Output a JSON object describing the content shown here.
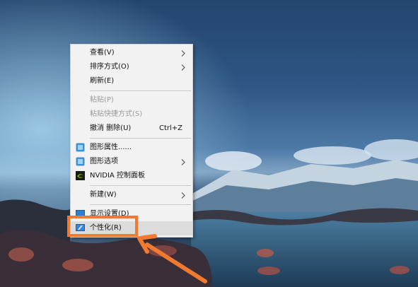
{
  "menu": {
    "items": [
      {
        "label": "查看(V)",
        "submenu": true
      },
      {
        "label": "排序方式(O)",
        "submenu": true
      },
      {
        "label": "刷新(E)"
      },
      {
        "label": "粘贴(P)",
        "disabled": true
      },
      {
        "label": "粘贴快捷方式(S)",
        "disabled": true
      },
      {
        "label": "撤消 删除(U)",
        "shortcut": "Ctrl+Z"
      },
      {
        "label": "图形属性......",
        "icon": "intel-graphics-icon"
      },
      {
        "label": "图形选项",
        "icon": "intel-graphics-icon",
        "submenu": true
      },
      {
        "label": "NVIDIA 控制面板",
        "icon": "nvidia-icon"
      },
      {
        "label": "新建(W)",
        "submenu": true
      },
      {
        "label": "显示设置(D)",
        "icon": "display-icon"
      },
      {
        "label": "个性化(R)",
        "icon": "personalize-icon",
        "highlighted": true
      }
    ]
  },
  "colors": {
    "annotation": "#f07a30",
    "menu_bg": "#f2f2f2",
    "disabled_text": "#9a9a9a"
  }
}
